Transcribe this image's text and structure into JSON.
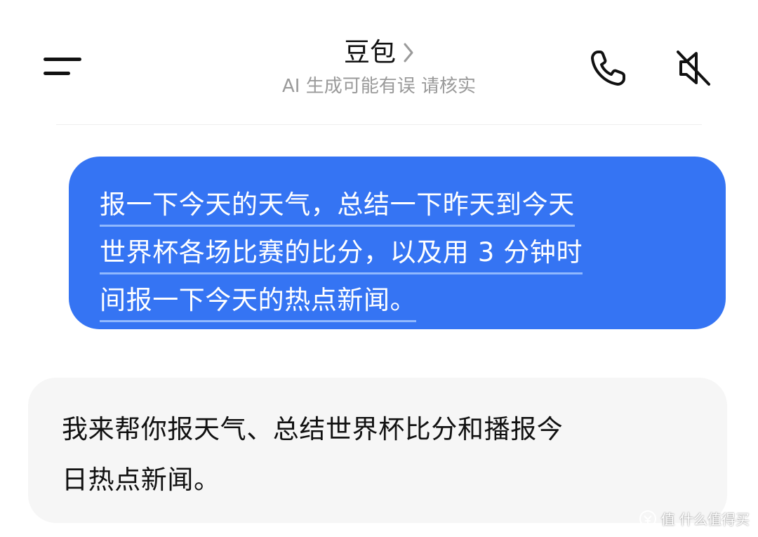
{
  "header": {
    "title": "豆包",
    "subtitle": "AI 生成可能有误 请核实"
  },
  "messages": {
    "user": {
      "lines": [
        "报一下今天的天气，总结一下昨天到今天",
        "世界杯各场比赛的比分，以及用 3 分钟时",
        "间报一下今天的热点新闻。"
      ]
    },
    "assistant": {
      "lines": [
        "我来帮你报天气、总结世界杯比分和播报今",
        "日热点新闻。"
      ]
    }
  },
  "watermark": {
    "text": "值 什么值得买"
  },
  "colors": {
    "user_bubble": "#3574f3",
    "assistant_bubble": "#f6f6f6",
    "subtitle": "#9a9a9a"
  },
  "icons": [
    "menu-icon",
    "chevron-right-icon",
    "phone-icon",
    "speaker-muted-icon"
  ]
}
